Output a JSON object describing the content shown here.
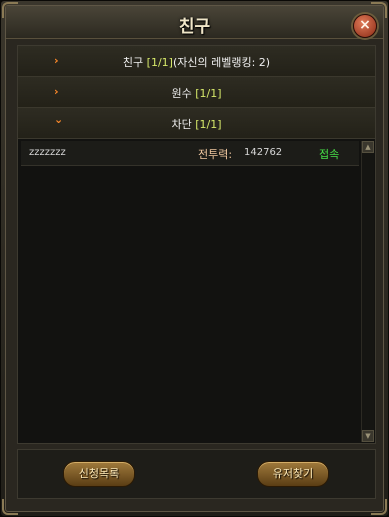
{
  "window": {
    "title": "친구",
    "close_icon": "×"
  },
  "groups": [
    {
      "prefix": "친구 ",
      "count": "[1/1]",
      "suffix": "(자신의 레벨랭킹: 2)",
      "state": "collapsed"
    },
    {
      "prefix": "원수 ",
      "count": "[1/1]",
      "suffix": "",
      "state": "collapsed"
    },
    {
      "prefix": "차단 ",
      "count": "[1/1]",
      "suffix": "",
      "state": "expanded"
    }
  ],
  "icons": {
    "collapsed": "›",
    "expanded": "⌄"
  },
  "list": {
    "rows": [
      {
        "name": "zzzzzzz",
        "power_label": "전투력:",
        "power_value": "142762",
        "status": "접속"
      }
    ]
  },
  "buttons": {
    "left": "신청목록",
    "right": "유저찾기"
  },
  "colors": {
    "accent_count": "#d6e86a",
    "online": "#46e046",
    "chevron": "#ff8a2a"
  }
}
